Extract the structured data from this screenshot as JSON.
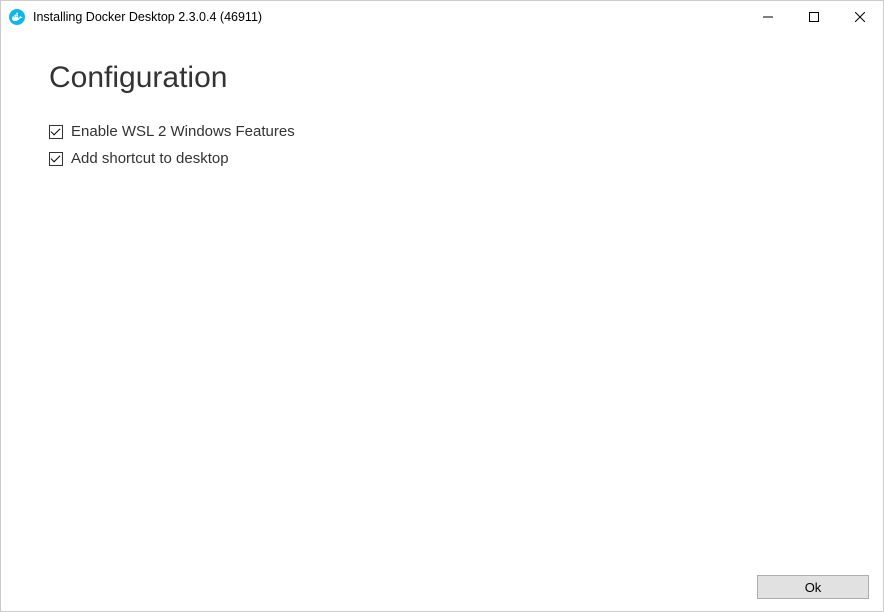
{
  "titlebar": {
    "title": "Installing Docker Desktop 2.3.0.4 (46911)"
  },
  "main": {
    "heading": "Configuration",
    "options": [
      {
        "label": "Enable WSL 2 Windows Features",
        "checked": true
      },
      {
        "label": "Add shortcut to desktop",
        "checked": true
      }
    ]
  },
  "footer": {
    "ok_label": "Ok"
  }
}
